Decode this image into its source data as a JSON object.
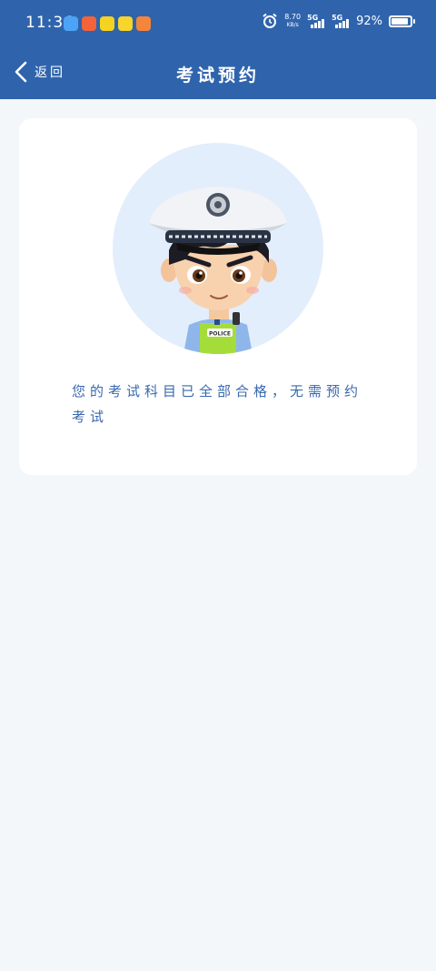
{
  "status_bar": {
    "time": "11:36",
    "net_speed_value": "8.70",
    "net_speed_unit": "KB/s",
    "signal_1_label": "5G",
    "signal_2_label": "5G",
    "battery_percent": "92%",
    "battery_level": 0.92
  },
  "header": {
    "back_label": "返回",
    "title": "考试预约"
  },
  "card": {
    "message": "您的考试科目已全部合格，无需预约考试",
    "badge_text": "POLICE"
  },
  "colors": {
    "header_bg": "#2f64ad",
    "page_bg": "#f4f7f9",
    "message_text": "#3a69ae",
    "avatar_bg": "#e3eefc"
  }
}
